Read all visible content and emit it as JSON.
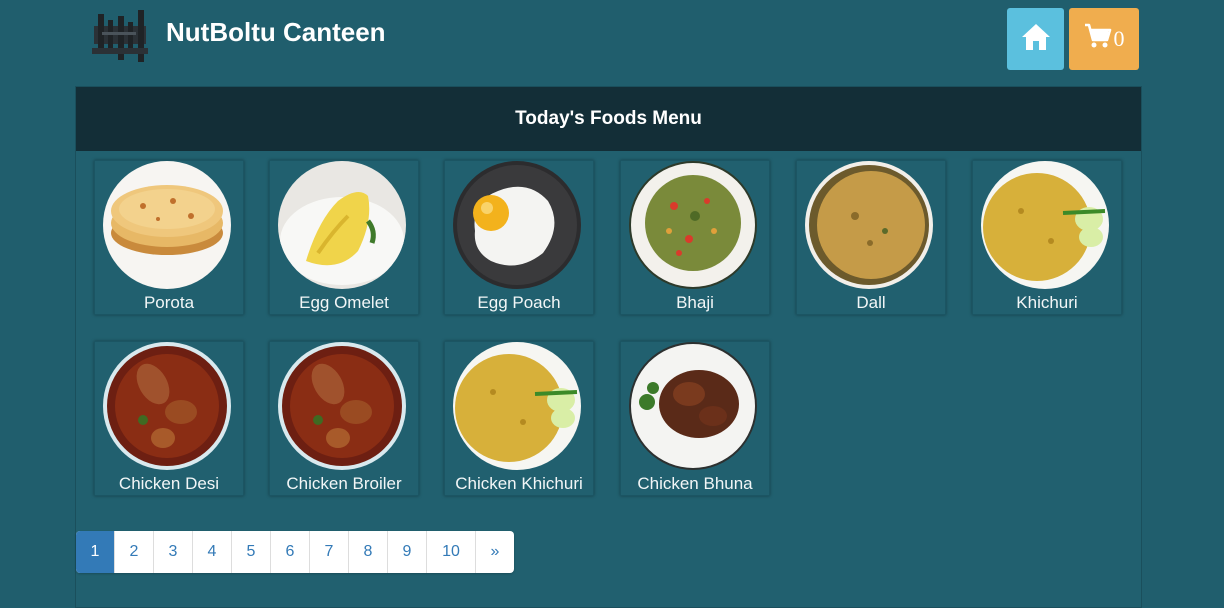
{
  "header": {
    "brand": "NutBoltu Canteen",
    "cart_count": "0",
    "home_icon": "home-icon",
    "cart_icon": "shopping-cart-icon"
  },
  "menu": {
    "title": "Today's Foods Menu",
    "items": [
      {
        "name": "Porota"
      },
      {
        "name": "Egg Omelet"
      },
      {
        "name": "Egg Poach"
      },
      {
        "name": "Bhaji"
      },
      {
        "name": "Dall"
      },
      {
        "name": "Khichuri"
      },
      {
        "name": "Chicken Desi"
      },
      {
        "name": "Chicken Broiler"
      },
      {
        "name": "Chicken Khichuri"
      },
      {
        "name": "Chicken Bhuna"
      }
    ]
  },
  "pagination": {
    "pages": [
      "1",
      "2",
      "3",
      "4",
      "5",
      "6",
      "7",
      "8",
      "9",
      "10"
    ],
    "active": "1",
    "next": "»"
  },
  "colors": {
    "background": "#205e6d",
    "heading_bg": "#132e37",
    "home_button": "#5bc0de",
    "cart_button": "#f0ad4e",
    "page_active": "#337ab7"
  }
}
